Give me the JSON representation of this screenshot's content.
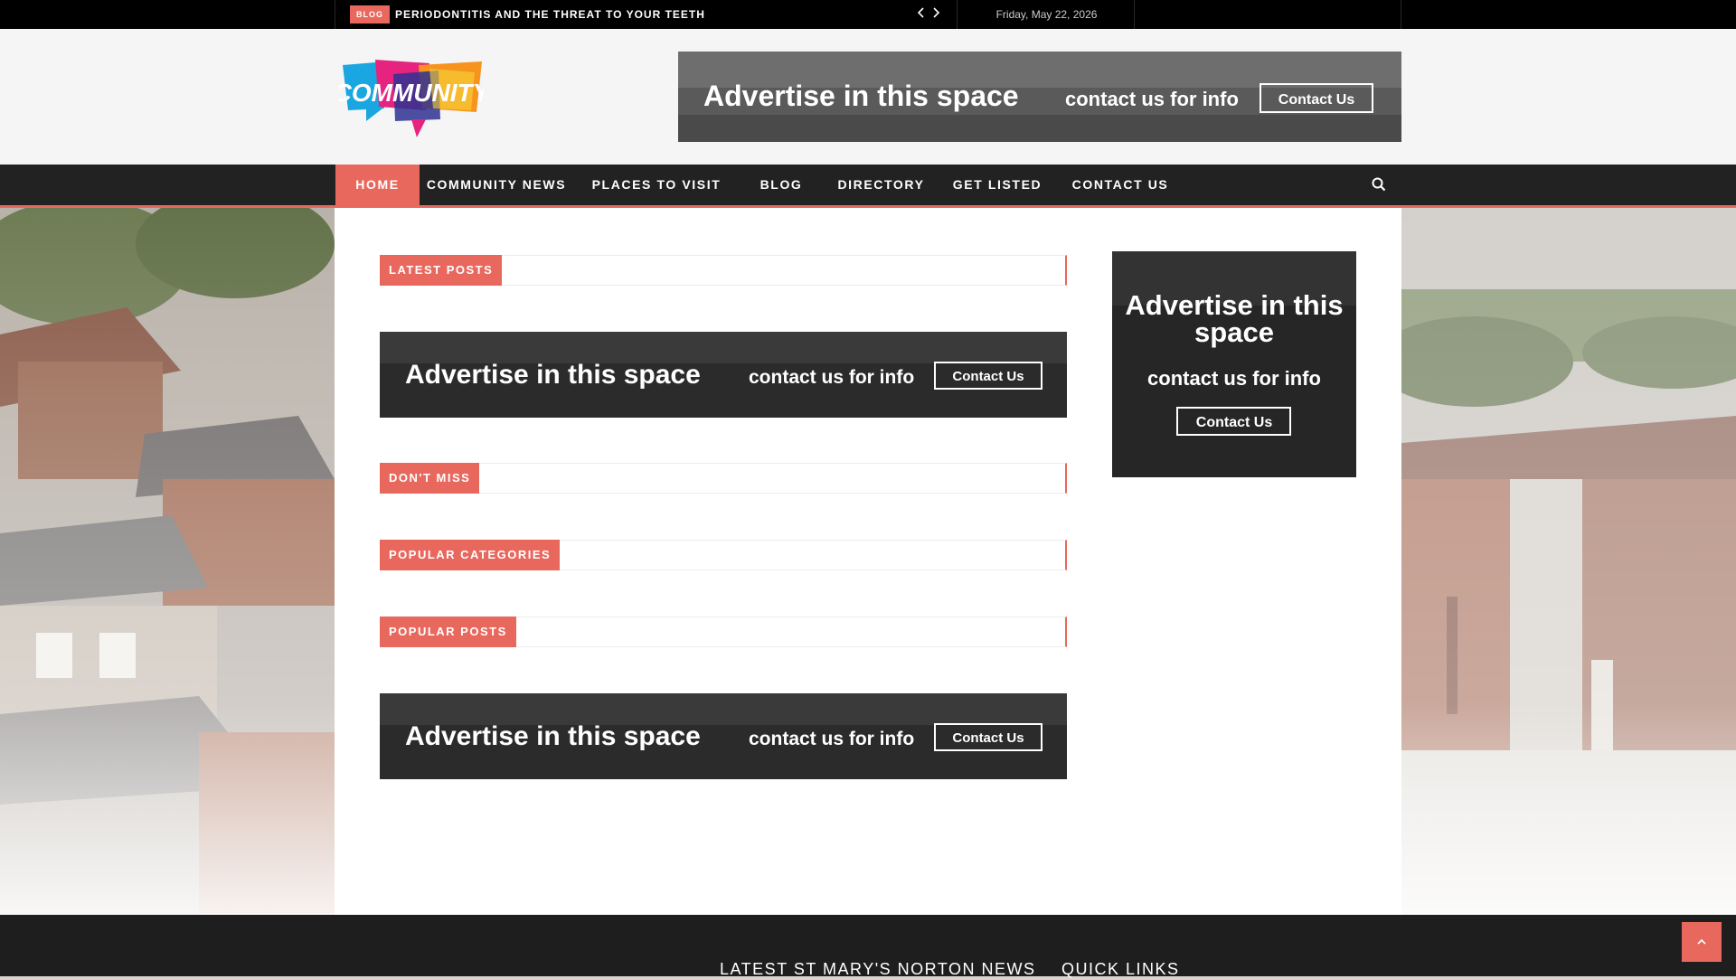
{
  "topbar": {
    "badge": "BLOG",
    "headline": "PERIODONTITIS AND THE THREAT TO YOUR TEETH",
    "prev_icon": "chevron-left-icon",
    "next_icon": "chevron-right-icon",
    "date": "Friday, May 22, 2026"
  },
  "header": {
    "logo_text": "COMMUNITY",
    "ad": {
      "headline": "Advertise in this space",
      "subline": "contact us for info",
      "button": "Contact Us"
    }
  },
  "nav": {
    "items": [
      {
        "label": "HOME",
        "active": true
      },
      {
        "label": "COMMUNITY NEWS"
      },
      {
        "label": "PLACES TO VISIT"
      },
      {
        "label": "BLOG"
      },
      {
        "label": "DIRECTORY"
      },
      {
        "label": "GET LISTED"
      },
      {
        "label": "CONTACT US"
      }
    ],
    "search_icon": "search-icon"
  },
  "main": {
    "latest_posts": "LATEST POSTS",
    "dont_miss": "DON'T MISS",
    "popular_categories": "POPULAR CATEGORIES",
    "popular_posts": "POPULAR POSTS",
    "ad_wide_1": {
      "headline": "Advertise in this space",
      "subline": "contact us for info",
      "button": "Contact Us"
    },
    "ad_wide_2": {
      "headline": "Advertise in this space",
      "subline": "contact us for info",
      "button": "Contact Us"
    }
  },
  "sidebar": {
    "ad": {
      "headline_line1": "Advertise in this",
      "headline_line2": "space",
      "subline": "contact us for info",
      "button": "Contact Us"
    }
  },
  "footer": {
    "col1_title": "LATEST ST MARY'S NORTON NEWS",
    "col2_title": "QUICK LINKS",
    "back_to_top_icon": "chevron-up-icon"
  },
  "colors": {
    "accent": "#e8685e",
    "nav_bg": "#222222",
    "topbar_bg": "#000000",
    "footer_bg": "#1e1e1e"
  }
}
